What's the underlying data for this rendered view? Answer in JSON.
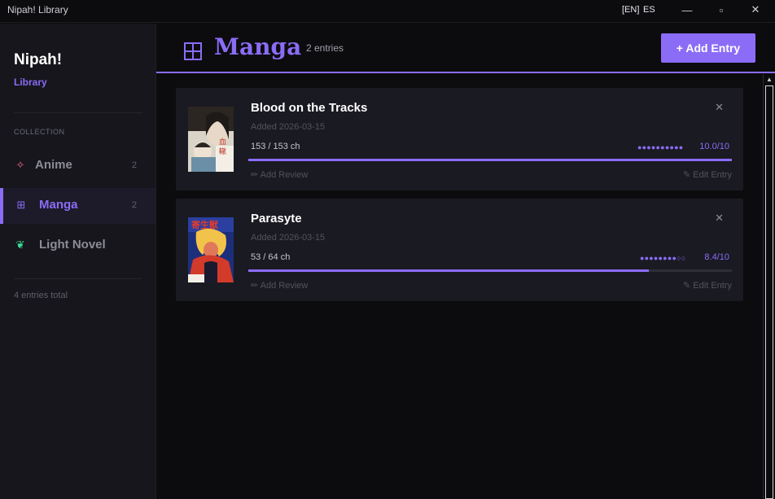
{
  "window": {
    "title": "Nipah! Library",
    "lang_en": "[EN]",
    "lang_es": "ES",
    "minimize_glyph": "—",
    "maximize_glyph": "▫",
    "close_glyph": "✕"
  },
  "sidebar": {
    "brand": "Nipah!",
    "brand_sub": "Library",
    "section_label": "COLLECTION",
    "items": [
      {
        "label": "Anime",
        "count": "2",
        "icon": "sparkle-icon",
        "glyph": "✧",
        "color": "#f06a8a"
      },
      {
        "label": "Manga",
        "count": "2",
        "icon": "grid-icon",
        "glyph": "⊞",
        "color": "#8b6cf6"
      },
      {
        "label": "Light Novel",
        "count": "",
        "icon": "leaf-icon",
        "glyph": "❦",
        "color": "#3ddc97"
      }
    ],
    "total": "4 entries total"
  },
  "header": {
    "title": "Manga",
    "count": "2 entries",
    "add_button": "+ Add Entry"
  },
  "entries": [
    {
      "title": "Blood on the Tracks",
      "added": "Added 2026-03-15",
      "progress": "153 / 153 ch",
      "progress_fraction": 1.0,
      "rating_dots": "●●●●●●●●●●",
      "score": "10.0/10",
      "review": "✏ Add Review",
      "edit": "✎ Edit Entry",
      "remove": "✕"
    },
    {
      "title": "Parasyte",
      "added": "Added 2026-03-15",
      "progress": "53 / 64 ch",
      "progress_fraction": 0.828,
      "rating_dots": "●●●●●●●●○○",
      "score": "8.4/10",
      "review": "✏ Add Review",
      "edit": "✎ Edit Entry",
      "remove": "✕"
    }
  ],
  "colors": {
    "accent": "#8b6cf6",
    "background": "#0c0c0f",
    "sidebar": "#16161c",
    "card": "#1a1a22"
  }
}
